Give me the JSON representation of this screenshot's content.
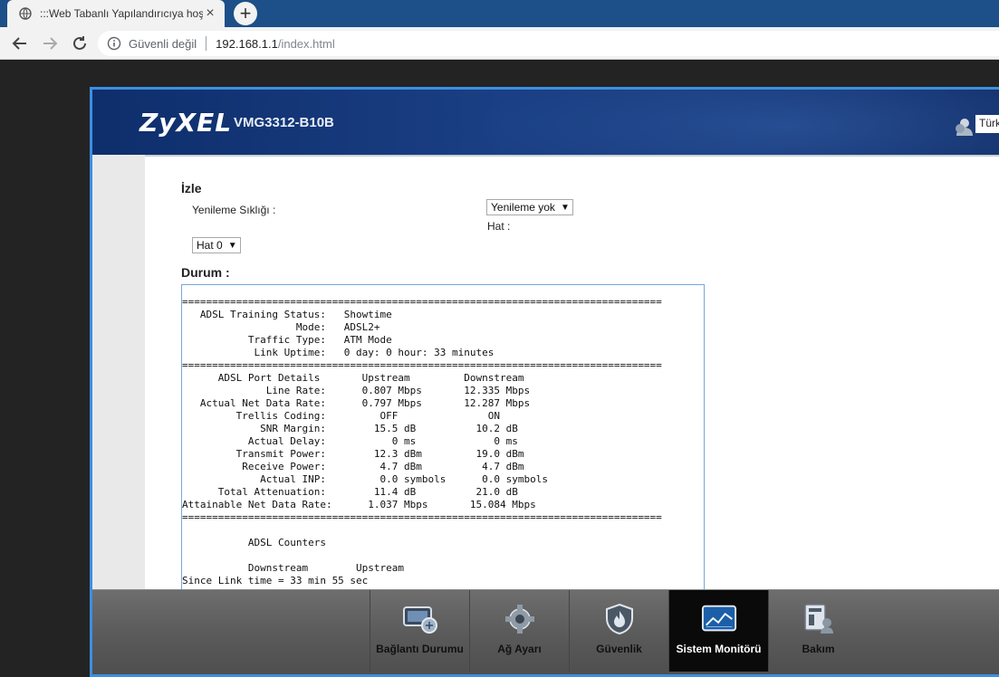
{
  "browser": {
    "tab_title": ":::Web Tabanlı Yapılandırıcıya hoş",
    "new_tab": "+",
    "close": "×",
    "security_label": "Güvenli değil",
    "url_host": "192.168.1.1",
    "url_path": "/index.html"
  },
  "router": {
    "brand": "ZyXEL",
    "model": "VMG3312-B10B",
    "language_label": "Türk"
  },
  "monitor": {
    "section_title": "İzle",
    "refresh_label": "Yenileme Sıklığı :",
    "refresh_value": "Yenileme yok",
    "line_label": "Hat :",
    "line_value": "Hat 0",
    "status_title": "Durum :",
    "status_text": "================================================================================\n   ADSL Training Status:   Showtime\n                   Mode:   ADSL2+\n           Traffic Type:   ATM Mode\n            Link Uptime:   0 day: 0 hour: 33 minutes\n================================================================================\n      ADSL Port Details       Upstream         Downstream\n              Line Rate:      0.807 Mbps       12.335 Mbps\n   Actual Net Data Rate:      0.797 Mbps       12.287 Mbps\n         Trellis Coding:         OFF               ON\n             SNR Margin:        15.5 dB          10.2 dB\n           Actual Delay:           0 ms             0 ms\n         Transmit Power:        12.3 dBm         19.0 dBm\n          Receive Power:         4.7 dBm          4.7 dBm\n             Actual INP:         0.0 symbols      0.0 symbols\n      Total Attenuation:        11.4 dB          21.0 dB\nAttainable Net Data Rate:      1.037 Mbps       15.084 Mbps\n================================================================================\n\n           ADSL Counters\n\n           Downstream        Upstream\nSince Link time = 33 min 55 sec"
  },
  "nav": {
    "items": [
      {
        "label": "Bağlantı Durumu",
        "icon": "connection-status-icon"
      },
      {
        "label": "Ağ Ayarı",
        "icon": "gear-icon"
      },
      {
        "label": "Güvenlik",
        "icon": "shield-icon"
      },
      {
        "label": "Sistem Monitörü",
        "icon": "monitor-chart-icon"
      },
      {
        "label": "Bakım",
        "icon": "maintenance-icon"
      }
    ]
  },
  "colors": {
    "tabbar": "#1d4f88",
    "header": "#1a3f84",
    "frame_border": "#3d8fe0",
    "status_border": "#7aa7d9",
    "active_nav": "#0a0a0a"
  }
}
